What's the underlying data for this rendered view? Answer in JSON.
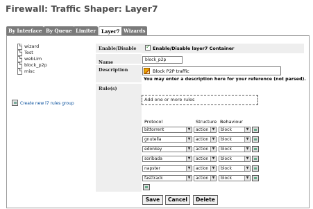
{
  "page": {
    "title": "Firewall: Traffic Shaper: Layer7"
  },
  "tabs": [
    {
      "label": "By Interface",
      "active": false
    },
    {
      "label": "By Queue",
      "active": false
    },
    {
      "label": "Limiter",
      "active": false
    },
    {
      "label": "Layer7",
      "active": true
    },
    {
      "label": "Wizards",
      "active": false
    }
  ],
  "tree": {
    "items": [
      {
        "label": "wizard"
      },
      {
        "label": "Test"
      },
      {
        "label": "webLim"
      },
      {
        "label": "block_p2p"
      },
      {
        "label": "misc"
      }
    ]
  },
  "create_link": {
    "label": "Create new l7 rules group"
  },
  "form": {
    "enable_label": "Enable/Disable",
    "enable_checkbox_label": "Enable/Disable layer7 Container",
    "enable_checked": true,
    "name_label": "Name",
    "name_value": "block_p2p",
    "description_label": "Description",
    "description_value": "Block P2P traffic",
    "description_help": "You may enter a description here for your reference (not parsed).",
    "rules_label": "Rule(s)",
    "add_rules_text": "Add one or more rules",
    "columns": {
      "protocol": "Protocol",
      "structure": "Structure",
      "behaviour": "Behaviour"
    },
    "rules": [
      {
        "protocol": "bittorrent",
        "structure": "action",
        "behaviour": "block"
      },
      {
        "protocol": "gnutella",
        "structure": "action",
        "behaviour": "block"
      },
      {
        "protocol": "edonkey",
        "structure": "action",
        "behaviour": "block"
      },
      {
        "protocol": "soribada",
        "structure": "action",
        "behaviour": "block"
      },
      {
        "protocol": "napster",
        "structure": "action",
        "behaviour": "block"
      },
      {
        "protocol": "fasttrack",
        "structure": "action",
        "behaviour": "block"
      }
    ]
  },
  "buttons": {
    "save": "Save",
    "cancel": "Cancel",
    "delete": "Delete"
  }
}
